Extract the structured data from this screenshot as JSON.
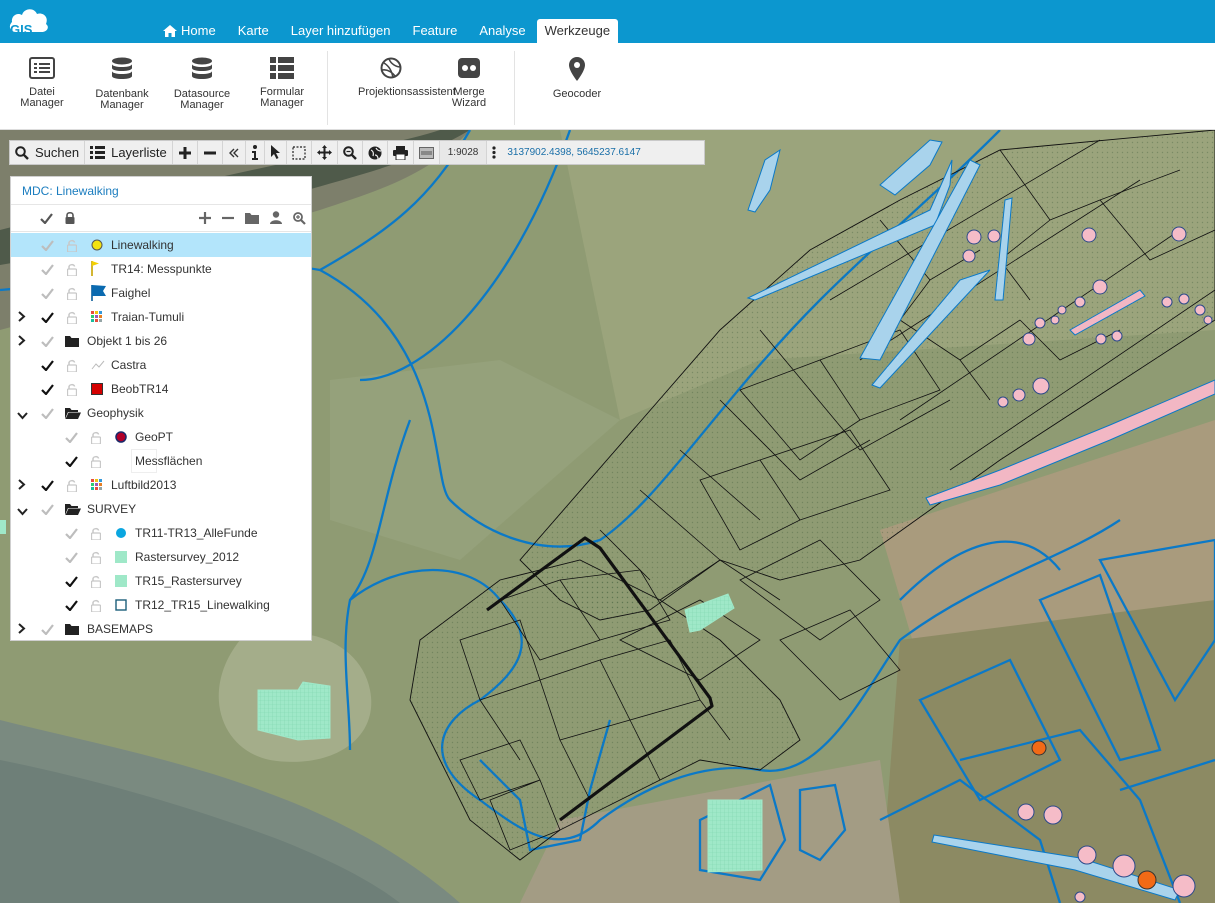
{
  "app": {
    "logo_text": "GIS",
    "tabs": [
      {
        "label": "Home",
        "icon": "home-icon"
      },
      {
        "label": "Karte"
      },
      {
        "label": "Layer hinzufügen"
      },
      {
        "label": "Feature"
      },
      {
        "label": "Analyse"
      },
      {
        "label": "Werkzeuge",
        "active": true
      }
    ]
  },
  "ribbon": {
    "buttons": [
      {
        "line1": "Datei",
        "line2": "Manager",
        "icon": "file-list-icon"
      },
      {
        "line1": "Datenbank",
        "line2": "Manager",
        "icon": "database-icon"
      },
      {
        "line1": "Datasource",
        "line2": "Manager",
        "icon": "database-icon"
      },
      {
        "line1": "Formular",
        "line2": "Manager",
        "icon": "form-list-icon"
      },
      {
        "line1": "Projektionsassistent",
        "line2": "",
        "icon": "globe-grid-icon"
      },
      {
        "line1": "Merge",
        "line2": "Wizard",
        "icon": "merge-icon"
      },
      {
        "line1": "Geocoder",
        "line2": "",
        "icon": "map-marker-icon"
      }
    ]
  },
  "toolbar": {
    "search_label": "Suchen",
    "layerlist_label": "Layerliste",
    "scale": "1:9028",
    "coordinates": "3137902.4398, 5645237.6147"
  },
  "panel": {
    "title": "MDC: Linewalking",
    "layers": [
      {
        "label": "Linewalking",
        "icon": "yellow-circle-icon",
        "selected": true,
        "checked": false,
        "depth": 0,
        "type": "layer"
      },
      {
        "label": "TR14: Messpunkte",
        "icon": "yellow-flag-icon",
        "checked": false,
        "depth": 0,
        "type": "layer"
      },
      {
        "label": "Faighel",
        "icon": "blue-flag-icon",
        "checked": false,
        "depth": 0,
        "type": "layer"
      },
      {
        "label": "Traian-Tumuli",
        "icon": "raster-icon",
        "checked": true,
        "depth": 0,
        "type": "layer",
        "expandable": true
      },
      {
        "label": "Objekt 1 bis 26",
        "icon": "folder-icon",
        "checked": false,
        "depth": 0,
        "type": "folder",
        "expandable": true
      },
      {
        "label": "Castra",
        "icon": "line-icon",
        "checked": true,
        "depth": 0,
        "type": "layer"
      },
      {
        "label": "BeobTR14",
        "icon": "red-square-icon",
        "checked": true,
        "depth": 0,
        "type": "layer"
      },
      {
        "label": "Geophysik",
        "icon": "folder-open-icon",
        "checked": false,
        "depth": 0,
        "type": "folder",
        "expanded": true
      },
      {
        "label": "GeoPT",
        "icon": "dark-red-circle-icon",
        "checked": false,
        "depth": 1,
        "type": "layer"
      },
      {
        "label": "Messflächen",
        "icon": "dotted-square-icon",
        "checked": true,
        "depth": 1,
        "type": "layer"
      },
      {
        "label": "Luftbild2013",
        "icon": "raster-icon",
        "checked": true,
        "depth": 0,
        "type": "layer",
        "expandable": true
      },
      {
        "label": "SURVEY",
        "icon": "folder-open-icon",
        "checked": false,
        "depth": 0,
        "type": "folder",
        "expanded": true
      },
      {
        "label": "TR11-TR13_AlleFunde",
        "icon": "cyan-circle-icon",
        "checked": false,
        "depth": 1,
        "type": "layer"
      },
      {
        "label": "Rastersurvey_2012",
        "icon": "green-square-icon",
        "checked": false,
        "depth": 1,
        "type": "layer"
      },
      {
        "label": "TR15_Rastersurvey",
        "icon": "green-square-icon",
        "checked": true,
        "depth": 1,
        "type": "layer"
      },
      {
        "label": "TR12_TR15_Linewalking",
        "icon": "teal-outline-square-icon",
        "checked": true,
        "depth": 1,
        "type": "layer"
      },
      {
        "label": "BASEMAPS",
        "icon": "folder-icon",
        "checked": false,
        "depth": 0,
        "type": "folder",
        "expandable": true
      }
    ]
  }
}
